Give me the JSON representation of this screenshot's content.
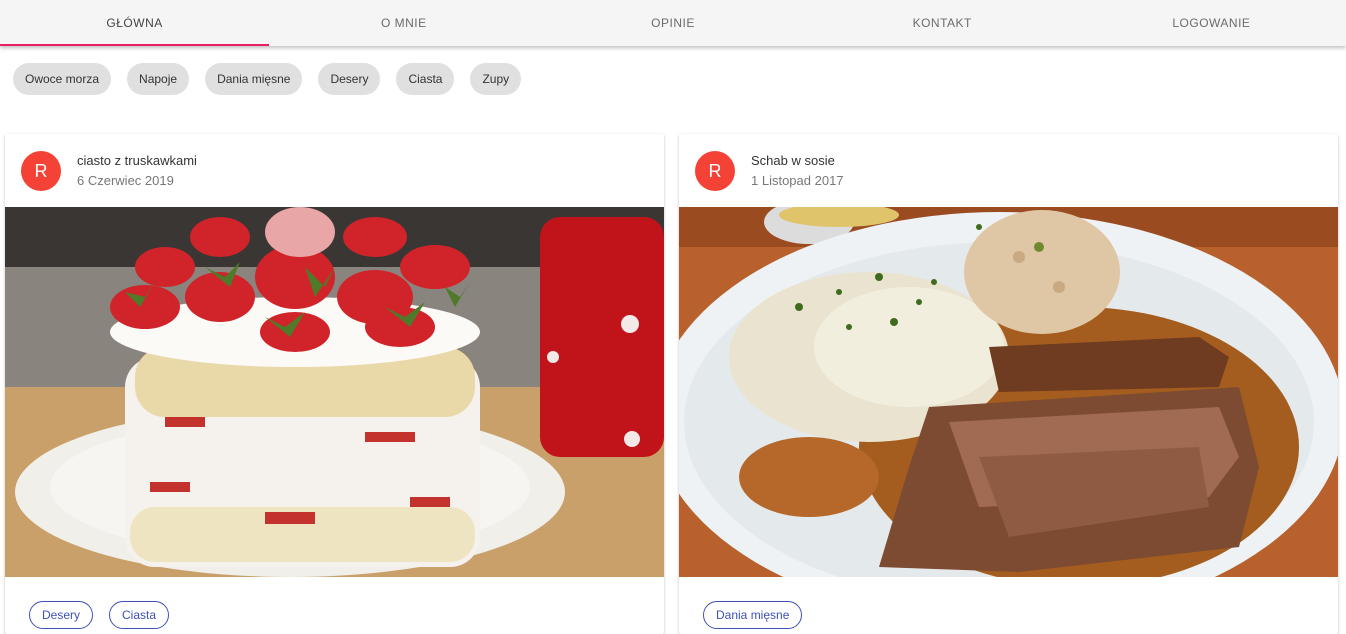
{
  "nav": {
    "tabs": [
      "GŁÓWNA",
      "O MNIE",
      "OPINIE",
      "KONTAKT",
      "LOGOWANIE"
    ],
    "active_index": 0,
    "accent": "#e91e63"
  },
  "categories": [
    "Owoce morza",
    "Napoje",
    "Dania mięsne",
    "Desery",
    "Ciasta",
    "Zupy"
  ],
  "posts": [
    {
      "avatar": "R",
      "title": "ciasto z truskawkami",
      "date": "6 Czerwiec 2019",
      "tags": [
        "Desery",
        "Ciasta"
      ]
    },
    {
      "avatar": "R",
      "title": "Schab w sosie",
      "date": "1 Listopad 2017",
      "tags": [
        "Dania mięsne"
      ]
    }
  ],
  "colors": {
    "avatar": "#f44336",
    "tag_outline": "#3f51b5",
    "chip_bg": "#e0e0e0"
  }
}
